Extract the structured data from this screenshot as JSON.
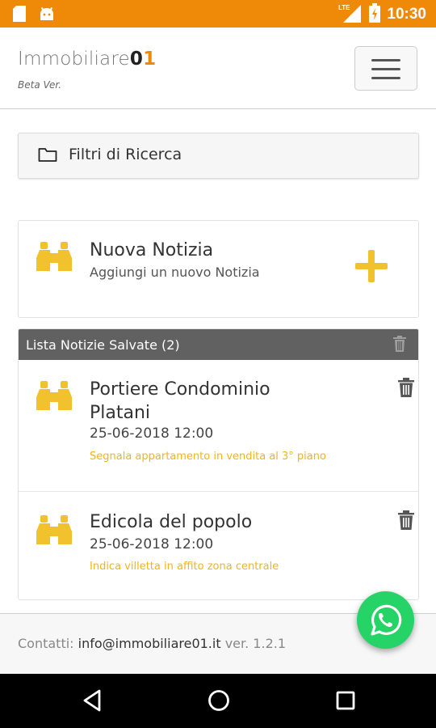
{
  "status_bar": {
    "time": "10:30",
    "network": "LTE",
    "icons": [
      "sd-card-icon",
      "android-icon",
      "signal-icon",
      "battery-icon"
    ]
  },
  "header": {
    "brand_text": "Immobiliare",
    "brand_number_first": "0",
    "brand_number_second": "1",
    "subtitle": "Beta Ver."
  },
  "filters": {
    "label": "Filtri di Ricerca"
  },
  "new_card": {
    "title": "Nuova Notizia",
    "subtitle": "Aggiungi un nuovo Notizia"
  },
  "saved_list": {
    "title": "Lista Notizie Salvate (2)",
    "items": [
      {
        "title": "Portiere Condominio Platani",
        "date": "25-06-2018 12:00",
        "description": "Segnala appartamento in vendita al 3° piano"
      },
      {
        "title": "Edicola del popolo",
        "date": "25-06-2018 12:00",
        "description": "Indica villetta in affito zona centrale"
      }
    ]
  },
  "footer": {
    "label": "Contatti:",
    "email": "info@immobiliare01.it",
    "version": "ver. 1.2.1"
  },
  "colors": {
    "status_bar": "#EE8A07",
    "accent_yellow": "#F2C12E",
    "header_gray": "#616161",
    "whatsapp_green": "#25D366"
  }
}
